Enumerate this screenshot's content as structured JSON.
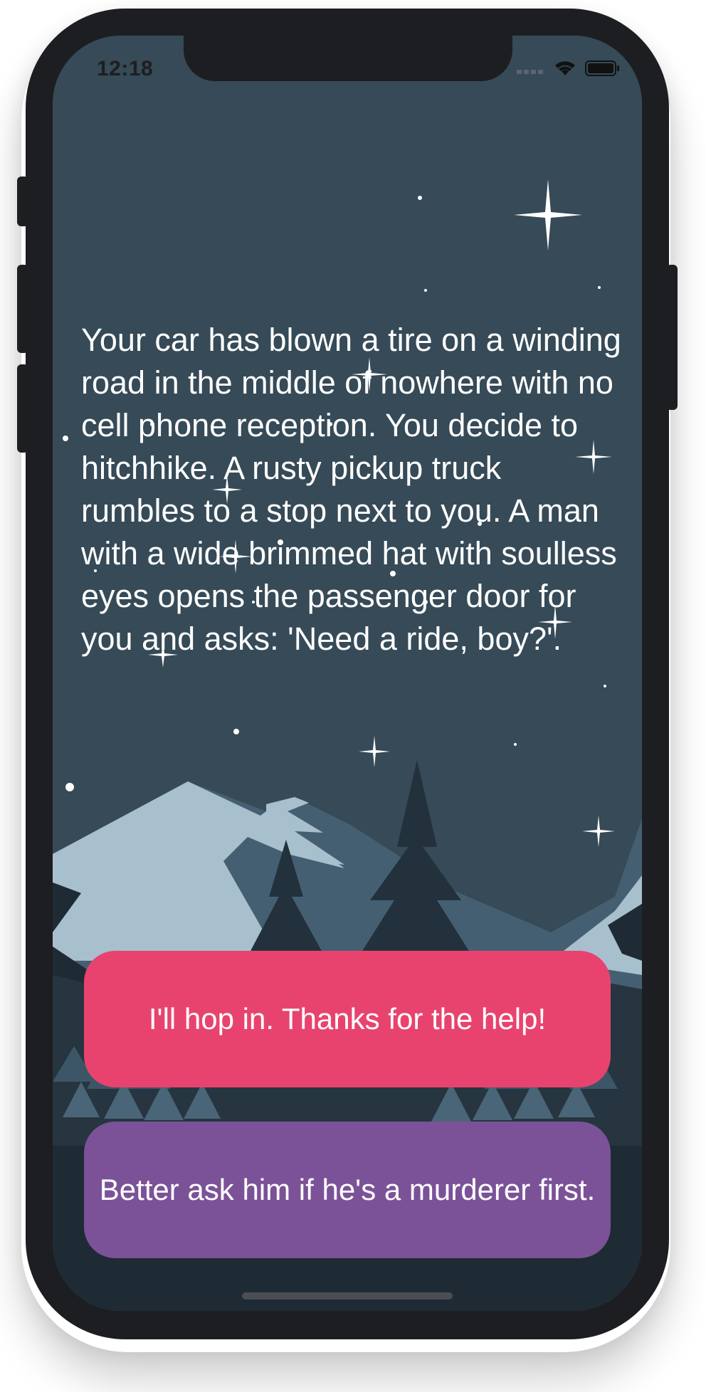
{
  "status_bar": {
    "time": "12:18",
    "icons": [
      "cellular-signal-icon",
      "wifi-icon",
      "battery-icon"
    ]
  },
  "story": {
    "text": "Your car has blown a tire on a winding road in the middle of nowhere with no cell phone reception. You decide to hitchhike. A rusty pickup truck rumbles to a stop next to you. A man with a wide brimmed hat with soulless eyes opens the passenger door for you and asks: 'Need a ride, boy?'."
  },
  "choices": [
    {
      "label": "I'll hop in. Thanks for the help!",
      "color": "#e8436e"
    },
    {
      "label": "Better ask him if he's a murderer first.",
      "color": "#7b5297"
    }
  ],
  "colors": {
    "sky": "#364a57",
    "ground": "#1f2b34",
    "device_frame": "#1d1e21"
  }
}
